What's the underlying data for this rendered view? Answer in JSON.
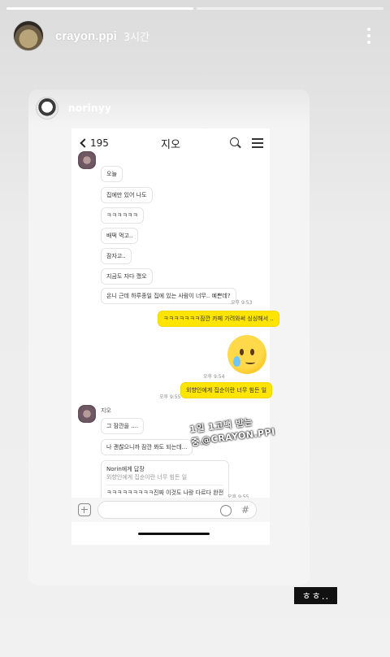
{
  "story": {
    "progress": [
      1.0,
      0.0
    ],
    "username": "crayon.ppi",
    "time": "3시간",
    "more_icon": "more-vertical-icon"
  },
  "repost": {
    "username": "norinyy"
  },
  "chat": {
    "back_count": "195",
    "title": "지오",
    "messages": [
      {
        "side": "them",
        "text": "오늘"
      },
      {
        "side": "them",
        "text": "집에만 있어 나도"
      },
      {
        "side": "them",
        "text": "ㅋㅋㅋㅋㅋㅋ"
      },
      {
        "side": "them",
        "text": "배떡 먹고.."
      },
      {
        "side": "them",
        "text": "잠자고.."
      },
      {
        "side": "them",
        "text": "지금도 자다 깼오"
      },
      {
        "side": "them",
        "text": "온니 근데 하루종일 집에 있는 사람이 너무.. 예쁜데?"
      },
      {
        "side": "them",
        "time": "오후 9:53"
      },
      {
        "side": "me",
        "text": "ㅋㅋㅋㅋㅋㅋㅋ잠깐 카페 가려와써 싱싱해서 .."
      },
      {
        "side": "me",
        "emoji": "crying-face"
      },
      {
        "side": "me",
        "time": "오후 9:54"
      },
      {
        "side": "me",
        "text": "외향인에게 집순이란 너무 힘든 일"
      },
      {
        "side": "me",
        "time": "오후 9:55"
      },
      {
        "side": "them",
        "sender": "지오"
      },
      {
        "side": "them",
        "text": "그 잠깐을 ...."
      },
      {
        "side": "them",
        "text": "나 괜찮으니까 잠깐 봐도 되는데..."
      },
      {
        "side": "them",
        "reply_to": "Norin에게 답장",
        "quote": "외향인에게 집순이란 너무 힘든 일",
        "text": "ㅋㅋㅋㅋㅋㅋㅋㅋㅋ진짜 이것도 나랑 다르다 완전"
      },
      {
        "side": "them",
        "time": "오후 9:55"
      }
    ],
    "sticker_lines": [
      "1일 1고백 받는 중..",
      "@CRAYON.PPI"
    ]
  },
  "caption": "ㅎㅎ.."
}
